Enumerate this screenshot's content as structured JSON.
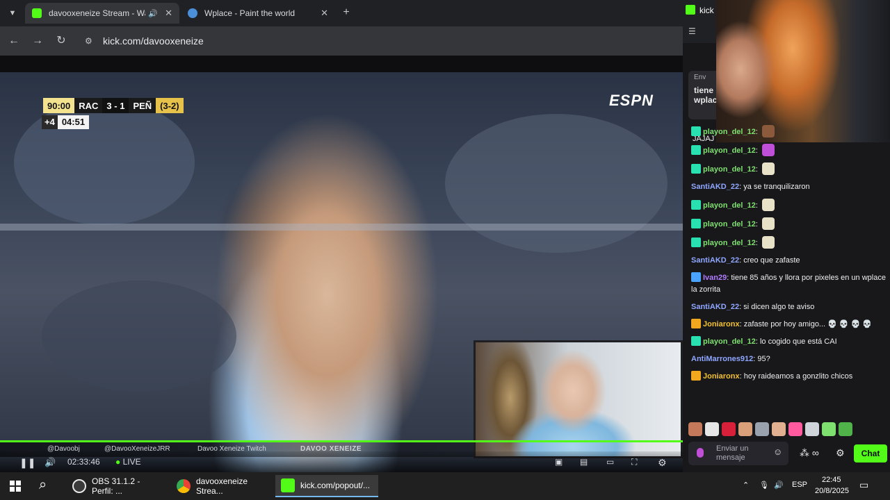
{
  "browser": {
    "tabs": [
      {
        "title": "davooxeneize Stream - Wat",
        "active": true
      },
      {
        "title": "Wplace - Paint the world",
        "active": false
      }
    ],
    "url": "kick.com/davooxeneize"
  },
  "scoreboard": {
    "time": "90:00",
    "home": "RAC",
    "score": "3 - 1",
    "away": "PEÑ",
    "aggregate": "(3-2)",
    "added": "+4",
    "added_time": "04:51",
    "network": "ESPN"
  },
  "lower_third": {
    "social_1": "@Davoobj",
    "social_2": "@DavooXeneizeJRR",
    "social_3": "Davoo Xeneize Twitch",
    "brand": "DAVOO XENEIZE"
  },
  "player_controls": {
    "elapsed": "02:33:46",
    "live": "LIVE"
  },
  "chat_window": {
    "title": "kick",
    "pinned_label": "Env",
    "pinned_text_1": "tiene",
    "pinned_text_2": "wplac",
    "first_msg": "JAJAJ"
  },
  "chat": [
    {
      "user": "playon_del_12",
      "text": "",
      "color": "#7ee06f",
      "emote": "#8b5a3c",
      "badge": "#29e0b0"
    },
    {
      "user": "playon_del_12",
      "text": "",
      "color": "#7ee06f",
      "emote": "#c04fd8",
      "badge": "#29e0b0"
    },
    {
      "user": "playon_del_12",
      "text": "",
      "color": "#7ee06f",
      "emote": "#e8e2c8",
      "badge": "#29e0b0"
    },
    {
      "user": "SantiAKD_22",
      "text": "ya se tranquilizaron",
      "color": "#8fa7ff",
      "emote": "",
      "badge": ""
    },
    {
      "user": "playon_del_12",
      "text": "",
      "color": "#7ee06f",
      "emote": "#e8e2c8",
      "badge": "#29e0b0"
    },
    {
      "user": "playon_del_12",
      "text": "",
      "color": "#7ee06f",
      "emote": "#e8e2c8",
      "badge": "#29e0b0"
    },
    {
      "user": "playon_del_12",
      "text": "",
      "color": "#7ee06f",
      "emote": "#e8e2c8",
      "badge": "#29e0b0"
    },
    {
      "user": "SantiAKD_22",
      "text": "creo que zafaste",
      "color": "#8fa7ff",
      "emote": "",
      "badge": ""
    },
    {
      "user": "Ivan29",
      "text": "tiene 85 años y llora por pixeles en un wplace la zorrita",
      "color": "#b07cff",
      "emote": "",
      "badge": "#4aa3ff"
    },
    {
      "user": "SantiAKD_22",
      "text": "si dicen algo te aviso",
      "color": "#8fa7ff",
      "emote": "",
      "badge": ""
    },
    {
      "user": "Joniaronx",
      "text": "zafaste por hoy amigo... 💀 💀 💀 💀",
      "color": "#f2c12e",
      "emote": "",
      "badge": "#f2a81e"
    },
    {
      "user": "playon_del_12",
      "text": "lo cogido que está CAI",
      "color": "#7ee06f",
      "emote": "",
      "badge": "#29e0b0"
    },
    {
      "user": "AntiMarrones912",
      "text": "95?",
      "color": "#8fa7ff",
      "emote": "",
      "badge": ""
    },
    {
      "user": "Joniaronx",
      "text": "hoy raideamos a gonzlito chicos",
      "color": "#f2c12e",
      "emote": "",
      "badge": "#f2a81e"
    }
  ],
  "chat_input": {
    "placeholder_1": "Enviar un",
    "placeholder_2": "mensaje",
    "button": "Chat"
  },
  "taskbar": {
    "apps": [
      {
        "label": "OBS 31.1.2 - Perfil: ...",
        "active": false
      },
      {
        "label": "davooxeneize Strea...",
        "active": false
      },
      {
        "label": "kick.com/popout/...",
        "active": true
      }
    ],
    "language": "ESP",
    "time": "22:45",
    "date": "20/8/2025"
  },
  "colors": {
    "kick_green": "#53fc18",
    "chat_bg": "#18181b",
    "taskbar_bg": "#202020"
  }
}
